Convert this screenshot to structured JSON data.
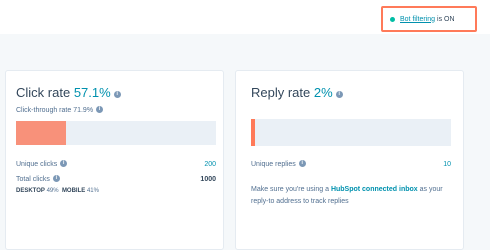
{
  "bot_filtering": {
    "link_text": "Bot filtering",
    "suffix": "is ON"
  },
  "click_card": {
    "title": "Click rate",
    "rate": "57.1%",
    "subtitle": "Click-through rate 71.9%",
    "bar_fill_percent": 25,
    "rows": [
      {
        "label": "Unique clicks",
        "value": "200"
      },
      {
        "label": "Total clicks",
        "value": "1000"
      }
    ],
    "devices": {
      "desktop_label": "DESKTOP",
      "desktop_value": "49%",
      "mobile_label": "MOBILE",
      "mobile_value": "41%"
    }
  },
  "reply_card": {
    "title": "Reply rate",
    "rate": "2%",
    "bar_fill_percent": 2,
    "rows": [
      {
        "label": "Unique replies",
        "value": "10"
      }
    ],
    "note": {
      "before": "Make sure you're using a ",
      "link": "HubSpot connected inbox",
      "after": " as your reply-to address to track replies"
    }
  },
  "colors": {
    "accent": "#0091ae",
    "bar_fill": "#f8917a",
    "highlight_border": "#ff7a59",
    "status_dot": "#00bda5"
  },
  "icons": [
    "status-dot-icon",
    "info-icon"
  ]
}
